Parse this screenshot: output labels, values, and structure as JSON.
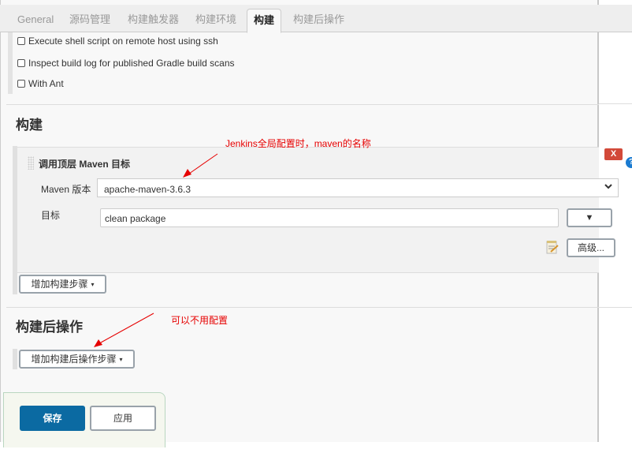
{
  "tabs": [
    {
      "label": "General",
      "active": false
    },
    {
      "label": "源码管理",
      "active": false
    },
    {
      "label": "构建触发器",
      "active": false
    },
    {
      "label": "构建环境",
      "active": false
    },
    {
      "label": "构建",
      "active": true
    },
    {
      "label": "构建后操作",
      "active": false
    }
  ],
  "build_env_options": [
    {
      "label": "Execute shell script on remote host using ssh",
      "checked": false
    },
    {
      "label": "Inspect build log for published Gradle build scans",
      "checked": false
    },
    {
      "label": "With Ant",
      "checked": false
    }
  ],
  "build_section": {
    "title": "构建",
    "step": {
      "title": "调用顶层 Maven 目标",
      "maven_version_label": "Maven 版本",
      "maven_version_value": "apache-maven-3.6.3",
      "goals_label": "目标",
      "goals_value": "clean package",
      "goals_dropdown_icon": "▼",
      "advanced_label": "高级...",
      "close_label": "X",
      "help_label": "?"
    },
    "add_step_label": "增加构建步骤"
  },
  "post_build_section": {
    "title": "构建后操作",
    "add_step_label": "增加构建后操作步骤"
  },
  "footer": {
    "save_label": "保存",
    "apply_label": "应用"
  },
  "annotations": {
    "maven_note": "Jenkins全局配置时，maven的名称",
    "post_note": "可以不用配置",
    "color": "#e60000"
  },
  "icons": {
    "caret": "▾",
    "select_chevron": "⌄"
  }
}
